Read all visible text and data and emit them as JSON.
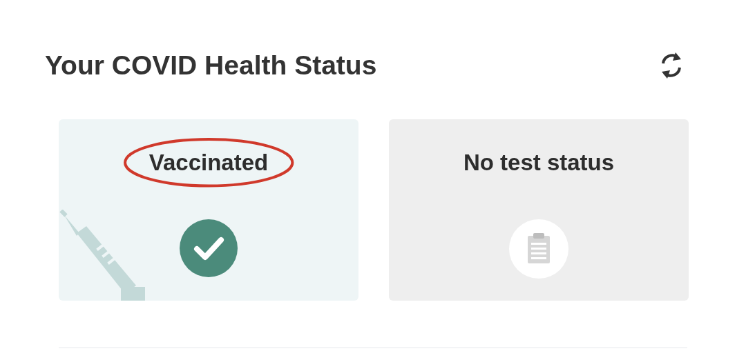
{
  "header": {
    "title": "Your COVID Health Status"
  },
  "cards": [
    {
      "kind": "vaccinated",
      "label": "Vaccinated",
      "circled": true
    },
    {
      "kind": "no-test",
      "label": "No test status",
      "circled": false
    }
  ]
}
